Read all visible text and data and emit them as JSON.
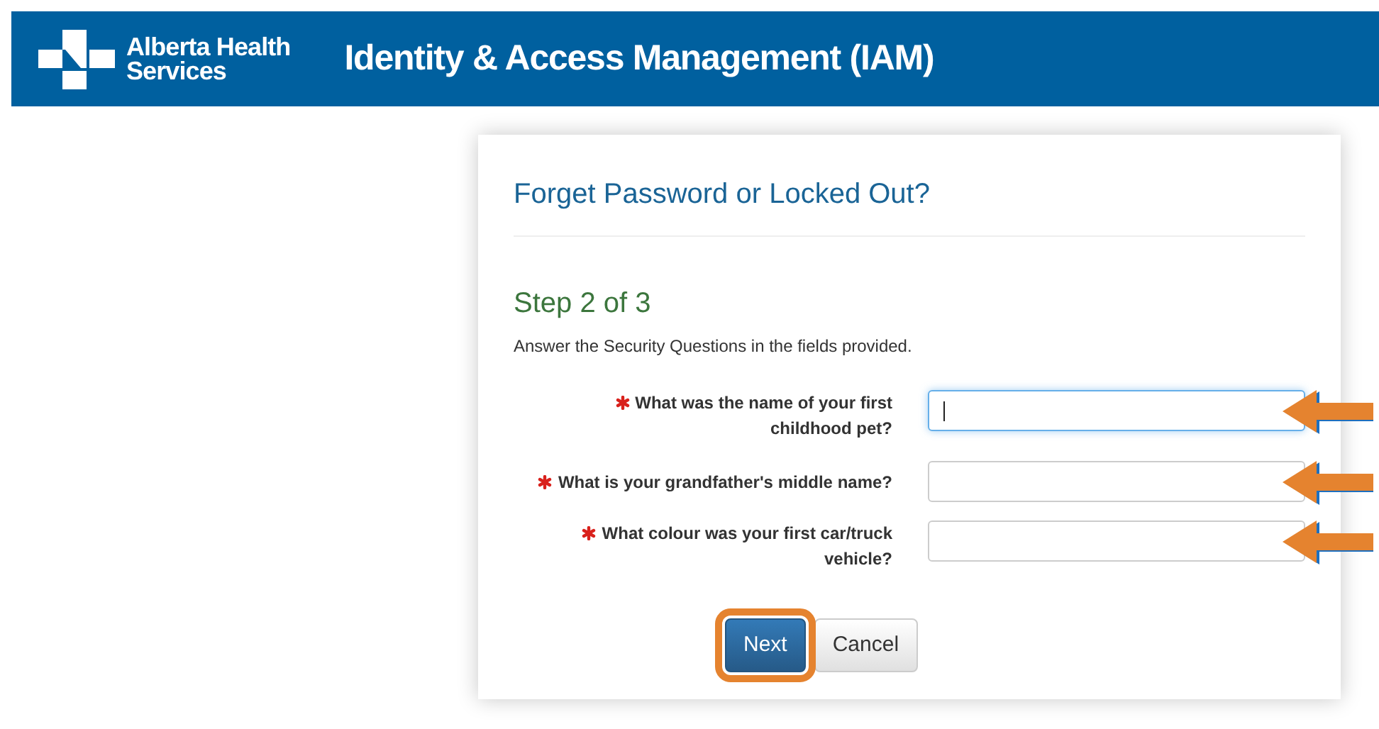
{
  "header": {
    "logo_text": [
      "Alberta Health",
      "Services"
    ],
    "title": "Identity & Access Management (IAM)"
  },
  "card": {
    "title": "Forget Password or Locked Out?",
    "step": "Step 2 of 3",
    "instruction": "Answer the Security Questions in the fields provided.",
    "questions": [
      {
        "label": "What was the name of your first childhood pet?",
        "required": true,
        "focused": true,
        "highlighted": true
      },
      {
        "label": "What is your grandfather's middle name?",
        "required": true,
        "focused": false,
        "highlighted": true
      },
      {
        "label": "What colour was your first car/truck vehicle?",
        "required": true,
        "focused": false,
        "highlighted": true
      }
    ],
    "buttons": [
      {
        "label": "Next",
        "kind": "primary",
        "highlighted": true
      },
      {
        "label": "Cancel",
        "kind": "default",
        "highlighted": false
      }
    ]
  }
}
